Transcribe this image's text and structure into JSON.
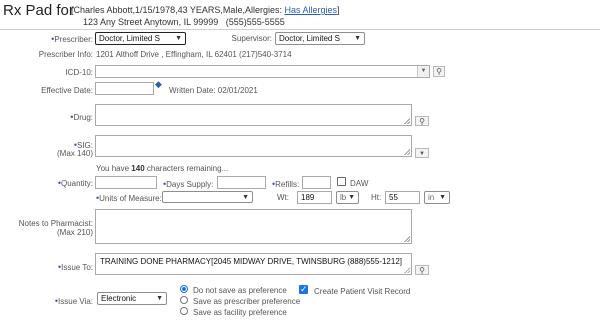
{
  "header": {
    "title": "Rx Pad for",
    "patient_line1": "[Charles Abbott,1/15/1978,43 YEARS,Male,Allergies:",
    "allergies_link": "Has Allergies",
    "patient_line1_end": "]",
    "patient_line2": "123 Any Street Anytown, IL 99999   (555)555-5555"
  },
  "prescriber": {
    "label": "Prescriber:",
    "value": "Doctor, Limited S"
  },
  "supervisor": {
    "label": "Supervisor:",
    "value": "Doctor, Limited S"
  },
  "prescriber_info": {
    "label": "Prescriber Info:",
    "value": "1201 Althoff Drive , Effingham, IL 62401  (217)540-3714"
  },
  "icd10": {
    "label": "ICD-10:",
    "value": ""
  },
  "effective_date": {
    "label": "Effective Date:",
    "value": "",
    "written_date": "Written Date: 02/01/2021"
  },
  "drug": {
    "label": "Drug:",
    "value": ""
  },
  "sig": {
    "label": "SIG:",
    "sublabel": "(Max 140)",
    "value": "",
    "remaining_prefix": "You have ",
    "remaining_count": "140",
    "remaining_suffix": " characters remaining..."
  },
  "quantity": {
    "label": "Quantity:",
    "value": ""
  },
  "days_supply": {
    "label": "Days Supply:",
    "value": ""
  },
  "refills": {
    "label": "Refills:",
    "value": ""
  },
  "daw": {
    "label": "DAW",
    "checked": false
  },
  "units": {
    "label": "Units of Measure:",
    "value": ""
  },
  "wt": {
    "label": "Wt:",
    "value": "189",
    "unit": "lb"
  },
  "ht": {
    "label": "Ht:",
    "value": "55",
    "unit": "in"
  },
  "notes": {
    "label": "Notes to Pharmacist:",
    "sublabel": "(Max 210)",
    "value": ""
  },
  "issue_to": {
    "label": "Issue To:",
    "value": "TRAINING DONE PHARMACY[2045 MIDWAY DRIVE, TWINSBURG (888)555-1212]"
  },
  "issue_via": {
    "label": "Issue Via:",
    "value": "Electronic"
  },
  "preference": {
    "options": [
      "Do not save as preference",
      "Save as prescriber preference",
      "Save as facility preference"
    ],
    "selected": 0
  },
  "patient_visit": {
    "label": "Create Patient Visit Record",
    "checked": true
  },
  "colors": {
    "accent": "#3a5fa8",
    "link": "#2a5fb0",
    "checkbox": "#1a73e8"
  }
}
